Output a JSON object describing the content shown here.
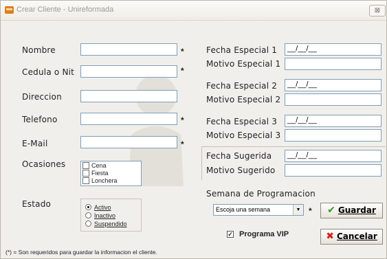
{
  "window": {
    "title": "Crear Cliente - Unireformada",
    "close_label": "⊠"
  },
  "left_form": {
    "nombre": {
      "label": "Nombre",
      "value": "",
      "required": "*"
    },
    "cedula": {
      "label": "Cedula o Nit",
      "value": "",
      "required": "*"
    },
    "direccion": {
      "label": "Direccion",
      "value": ""
    },
    "telefono": {
      "label": "Telefono",
      "value": "",
      "required": "*"
    },
    "email": {
      "label": "E-Mail",
      "value": "",
      "required": "*"
    },
    "ocasiones": {
      "label": "Ocasiones",
      "options": [
        "Cena",
        "Fiesta",
        "Lonchera"
      ]
    },
    "estado": {
      "label": "Estado",
      "options": [
        "Activo",
        "Inactivo",
        "Suspendido"
      ],
      "selected": "Activo"
    }
  },
  "right_form": {
    "fecha_especial_1": {
      "label": "Fecha Especial 1",
      "value": "__/__/__"
    },
    "motivo_especial_1": {
      "label": "Motivo Especial 1",
      "value": ""
    },
    "fecha_especial_2": {
      "label": "Fecha Especial 2",
      "value": "__/__/__"
    },
    "motivo_especial_2": {
      "label": "Motivo Especial 2",
      "value": ""
    },
    "fecha_especial_3": {
      "label": "Fecha Especial 3",
      "value": "__/__/__"
    },
    "motivo_especial_3": {
      "label": "Motivo Especial 3",
      "value": ""
    },
    "fecha_sugerida": {
      "label": "Fecha Sugerida",
      "value": "__/__/__"
    },
    "motivo_sugerido": {
      "label": "Motivo Sugerido",
      "value": ""
    }
  },
  "programacion": {
    "label": "Semana de Programacion",
    "select_value": "Escoja una semana",
    "required": "*",
    "vip_label": "Programa VIP",
    "vip_checked": true
  },
  "buttons": {
    "guardar": "Guardar",
    "cancelar": "Cancelar"
  },
  "footnote": "(*) = Son requeridos para guardar la informacion el cliente.",
  "colors": {
    "window_bg": "#f0efeb",
    "field_border": "#7f9db9",
    "guardar_icon": "#2e9a1d",
    "cancelar_icon": "#d0261b"
  }
}
